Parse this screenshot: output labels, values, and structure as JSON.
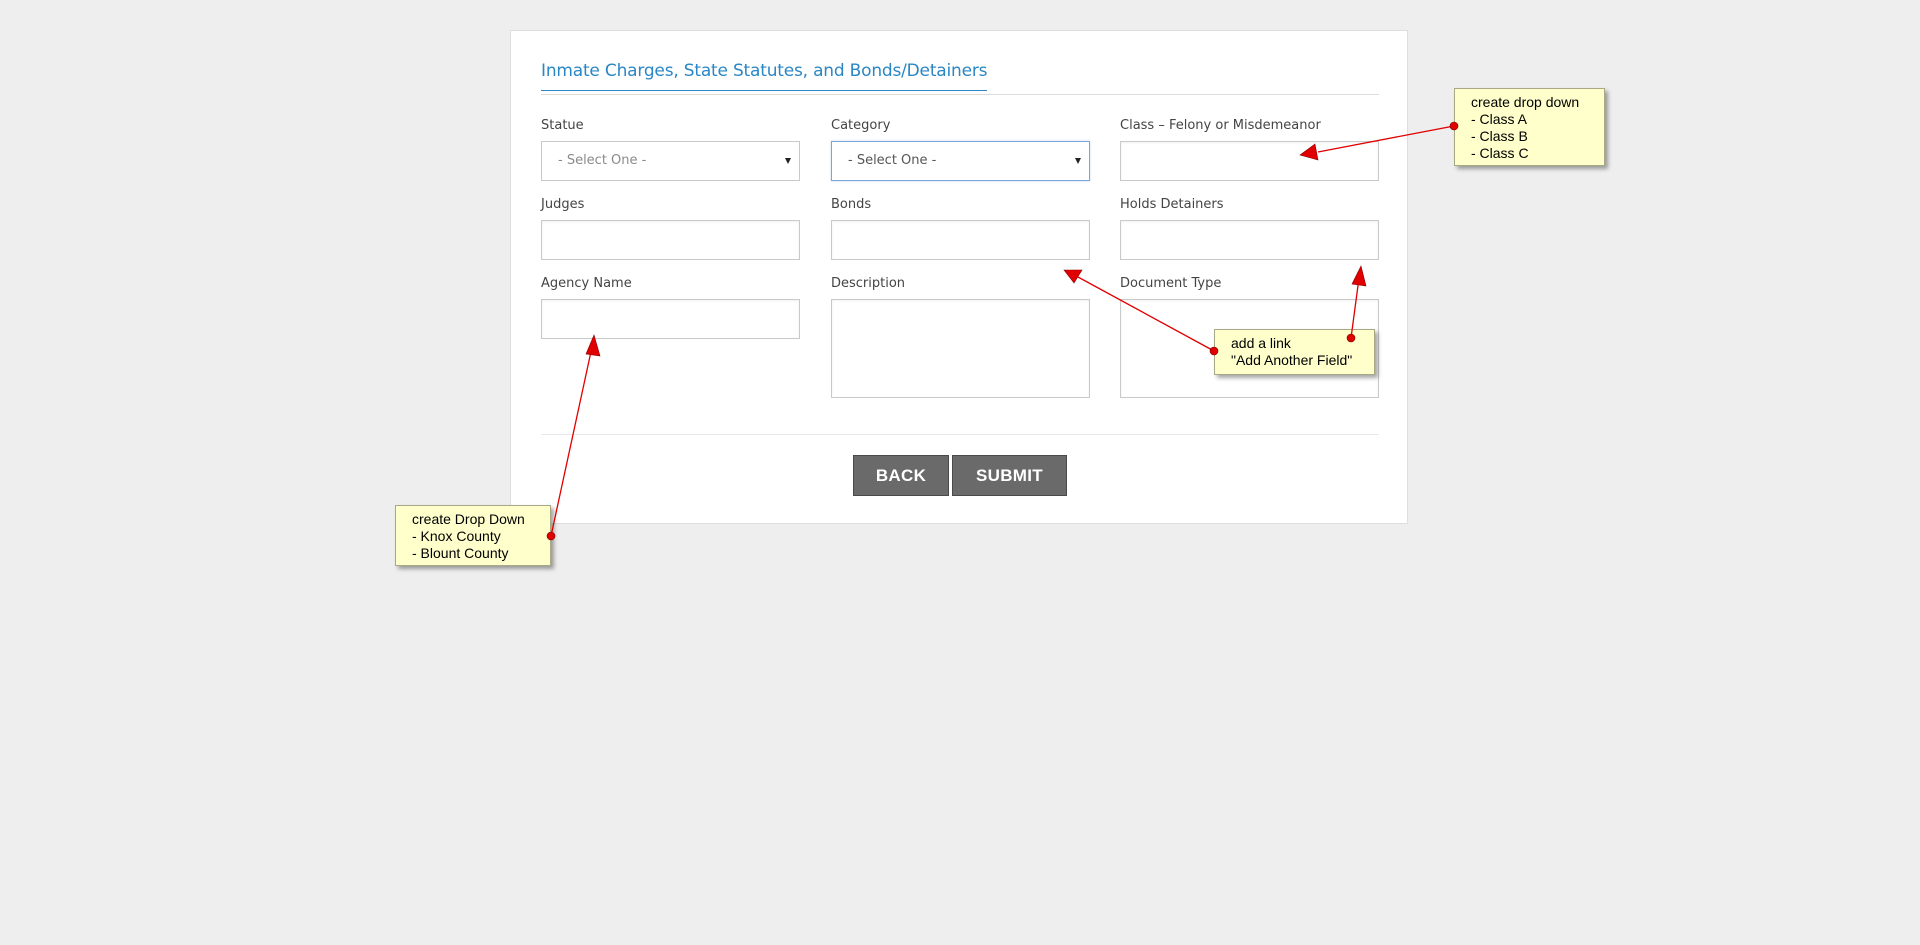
{
  "form": {
    "title": "Inmate Charges, State Statutes, and Bonds/Detainers",
    "fields": {
      "statue": {
        "label": "Statue",
        "value": "- Select One -"
      },
      "category": {
        "label": "Category",
        "value": "- Select One -"
      },
      "class": {
        "label": "Class – Felony or Misdemeanor"
      },
      "judges": {
        "label": "Judges"
      },
      "bonds": {
        "label": "Bonds"
      },
      "holds_detainers": {
        "label": "Holds Detainers"
      },
      "agency_name": {
        "label": "Agency Name"
      },
      "description": {
        "label": "Description"
      },
      "document_type": {
        "label": "Document Type"
      }
    },
    "buttons": {
      "back": "BACK",
      "submit": "SUBMIT"
    }
  },
  "annotations": {
    "class_note": {
      "lines": [
        "create drop down",
        "- Class A",
        "- Class B",
        "- Class C"
      ]
    },
    "add_field_note": {
      "lines": [
        "add a link",
        "\"Add Another Field\""
      ]
    },
    "agency_note": {
      "lines": [
        "create Drop Down",
        "- Knox County",
        "- Blount County"
      ]
    }
  },
  "colors": {
    "title": "#2a86c4",
    "button": "#6a6a6a",
    "note_bg": "#ffffcc",
    "arrow": "#e00000",
    "page_bg": "#eeeeee"
  },
  "icons": {
    "select_caret": "caret-down-icon"
  }
}
